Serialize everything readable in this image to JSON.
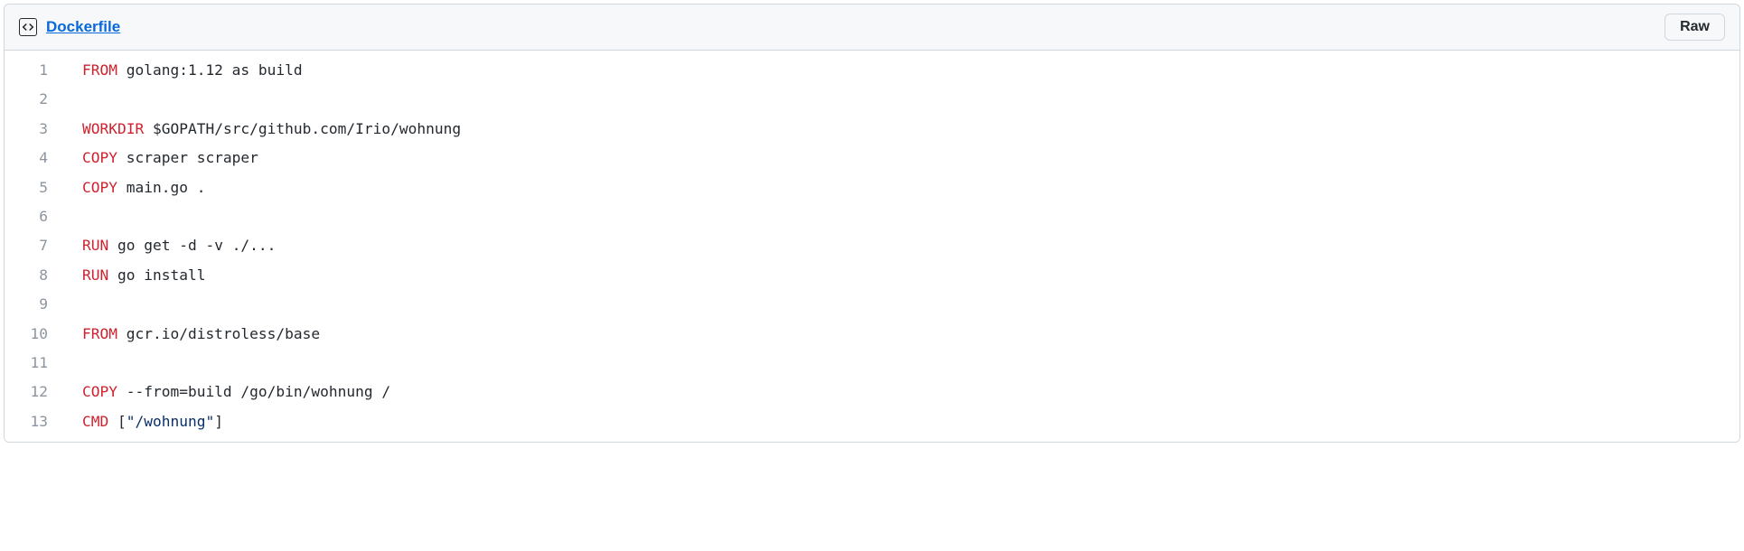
{
  "header": {
    "filename": "Dockerfile",
    "raw_label": "Raw"
  },
  "code": {
    "lines": [
      {
        "num": 1,
        "tokens": [
          {
            "t": "keyword",
            "v": "FROM"
          },
          {
            "t": "plain",
            "v": " golang:1.12 as build"
          }
        ]
      },
      {
        "num": 2,
        "tokens": []
      },
      {
        "num": 3,
        "tokens": [
          {
            "t": "keyword",
            "v": "WORKDIR"
          },
          {
            "t": "plain",
            "v": " $GOPATH/src/github.com/Irio/wohnung"
          }
        ]
      },
      {
        "num": 4,
        "tokens": [
          {
            "t": "keyword",
            "v": "COPY"
          },
          {
            "t": "plain",
            "v": " scraper scraper"
          }
        ]
      },
      {
        "num": 5,
        "tokens": [
          {
            "t": "keyword",
            "v": "COPY"
          },
          {
            "t": "plain",
            "v": " main.go ."
          }
        ]
      },
      {
        "num": 6,
        "tokens": []
      },
      {
        "num": 7,
        "tokens": [
          {
            "t": "keyword",
            "v": "RUN"
          },
          {
            "t": "plain",
            "v": " go get -d -v ./..."
          }
        ]
      },
      {
        "num": 8,
        "tokens": [
          {
            "t": "keyword",
            "v": "RUN"
          },
          {
            "t": "plain",
            "v": " go install"
          }
        ]
      },
      {
        "num": 9,
        "tokens": []
      },
      {
        "num": 10,
        "tokens": [
          {
            "t": "keyword",
            "v": "FROM"
          },
          {
            "t": "plain",
            "v": " gcr.io/distroless/base"
          }
        ]
      },
      {
        "num": 11,
        "tokens": []
      },
      {
        "num": 12,
        "tokens": [
          {
            "t": "keyword",
            "v": "COPY"
          },
          {
            "t": "plain",
            "v": " --from=build /go/bin/wohnung /"
          }
        ]
      },
      {
        "num": 13,
        "tokens": [
          {
            "t": "keyword",
            "v": "CMD"
          },
          {
            "t": "plain",
            "v": " ["
          },
          {
            "t": "string",
            "v": "\"/wohnung\""
          },
          {
            "t": "plain",
            "v": "]"
          }
        ]
      }
    ]
  }
}
